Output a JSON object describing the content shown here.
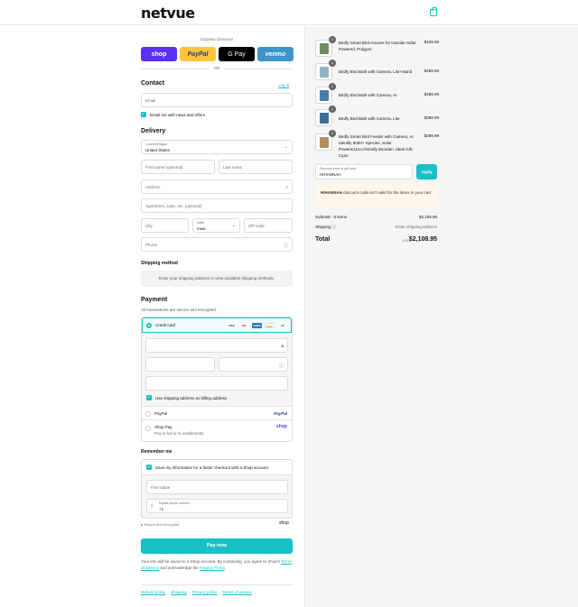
{
  "brand": {
    "logo": "netvue",
    "accent": "#19c0c4"
  },
  "express": {
    "label": "Express checkout",
    "shop": "shop",
    "paypal": "PayPal",
    "gpay": "G Pay",
    "venmo": "venmo",
    "or": "OR"
  },
  "contact": {
    "title": "Contact",
    "login": "Log in",
    "email_placeholder": "Email",
    "news_label": "Email me with news and offers"
  },
  "delivery": {
    "title": "Delivery",
    "country_label": "Country/Region",
    "country_value": "United States",
    "first_name": "First name (optional)",
    "last_name": "Last name",
    "address": "Address",
    "apartment": "Apartment, suite, etc. (optional)",
    "city": "City",
    "state_label": "State",
    "state_value": "Iowa",
    "zip": "ZIP code",
    "phone": "Phone"
  },
  "shipping_method": {
    "title": "Shipping method",
    "note": "Enter your shipping address to view available shipping methods."
  },
  "payment": {
    "title": "Payment",
    "note": "All transactions are secure and encrypted.",
    "credit_card": "Credit card",
    "cards": [
      "VISA",
      "MC",
      "AMEX",
      "DISC"
    ],
    "more_cards": "+3",
    "billing_label": "Use shipping address as billing address",
    "paypal": "PayPal",
    "paypal_brand": "PayPal",
    "shop_pay": "Shop Pay",
    "shop_pay_sub": "Pay in full or in installments",
    "shop_brand": "shop"
  },
  "remember": {
    "title": "Remember me",
    "save_label": "Save my information for a faster checkout with a Shop account",
    "first_name": "First name",
    "mobile_label": "Mobile phone number",
    "mobile_value": "+1",
    "secure": "Secure and encrypted",
    "shop": "shop"
  },
  "pay_now": "Pay now",
  "legal": {
    "text1": "Your info will be saved to a Shop account. By continuing, you agree to Shop's ",
    "terms": "Terms of Service",
    "text2": " and acknowledge the ",
    "privacy": "Privacy Policy",
    "text3": "."
  },
  "footer": [
    "Refund policy",
    "Shipping",
    "Privacy policy",
    "Terms of service"
  ],
  "order": {
    "items": [
      {
        "qty": "1",
        "name": "Birdfy Smart Bird Houses for Outside Solar Powered, Polygon",
        "price": "$429.99",
        "color": "#6b8f5e"
      },
      {
        "qty": "1",
        "name": "Birdfy Bird Bath with Camera, Lite+stand",
        "price": "$489.99",
        "color": "#8fb3c7"
      },
      {
        "qty": "1",
        "name": "Birdfy Bird Bath with Camera, AI",
        "price": "$489.99",
        "color": "#4a7ba8"
      },
      {
        "qty": "1",
        "name": "Birdfy Bird Bath with Camera, Lite",
        "price": "$399.99",
        "color": "#3f6f99"
      },
      {
        "qty": "1",
        "name": "Birdfy Smart Bird Feeder with Camera, AI Identify 6000+ Species, Solar Powered,Eco-friendly Wooden, Ideal Gift, Cyan",
        "price": "$299.99",
        "color": "#b58d5a"
      }
    ],
    "discount_label": "Discount code or gift card",
    "discount_value": "HIHANNAH",
    "apply": "Apply",
    "warning_code": "HIHANNAH",
    "warning_text": " discount code isn't valid for the items in your cart",
    "subtotal_label": "Subtotal · 5 items",
    "subtotal_value": "$2,108.95",
    "shipping_label": "Shipping",
    "shipping_value": "Enter shipping address",
    "total_label": "Total",
    "currency": "USD",
    "total_value": "$2,108.95"
  }
}
